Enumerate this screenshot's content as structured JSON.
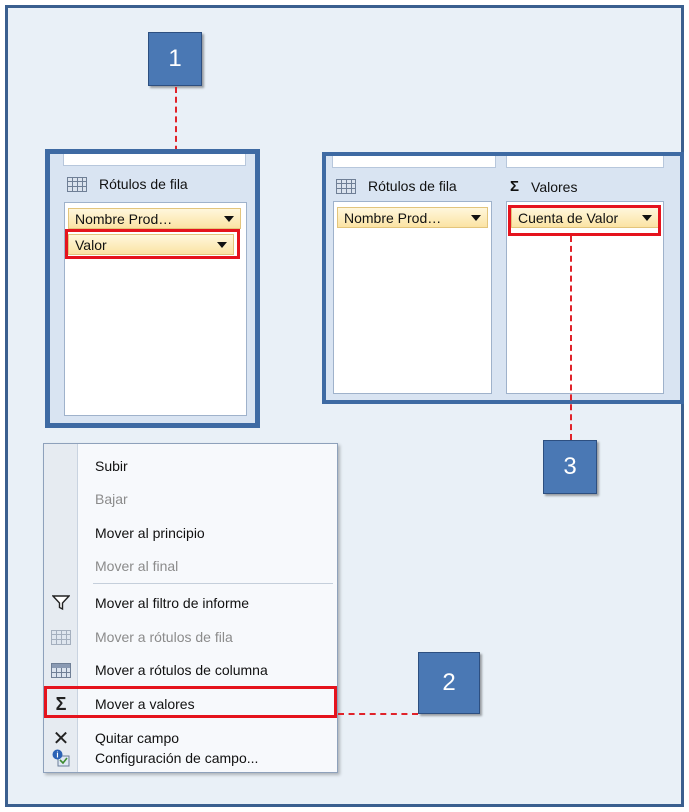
{
  "callouts": {
    "one": "1",
    "two": "2",
    "three": "3"
  },
  "panel_a": {
    "header": "Rótulos de fila",
    "fields": [
      {
        "label": "Nombre Prod…"
      },
      {
        "label": "Valor"
      }
    ]
  },
  "panel_b": {
    "rows_header": "Rótulos de fila",
    "values_symbol": "Σ",
    "values_header": "Valores",
    "rows_field": "Nombre Prod…",
    "values_field": "Cuenta de Valor"
  },
  "menu": {
    "items": [
      {
        "label": "Subir",
        "icon": "",
        "enabled": true
      },
      {
        "label": "Bajar",
        "icon": "",
        "enabled": false
      },
      {
        "label": "Mover al principio",
        "icon": "",
        "enabled": true
      },
      {
        "label": "Mover al final",
        "icon": "",
        "enabled": false
      },
      {
        "label": "Mover al filtro de informe",
        "icon": "filter-icon",
        "enabled": true
      },
      {
        "label": "Mover a rótulos de fila",
        "icon": "row-labels-icon",
        "enabled": false
      },
      {
        "label": "Mover a rótulos de columna",
        "icon": "column-labels-icon",
        "enabled": true
      },
      {
        "label": "Mover a valores",
        "icon": "sigma-icon",
        "symbol": "Σ",
        "enabled": true
      },
      {
        "label": "Quitar campo",
        "icon": "remove-icon",
        "symbol": "✕",
        "enabled": true
      },
      {
        "label": "Configuración de campo...",
        "icon": "field-settings-icon",
        "enabled": true
      }
    ]
  },
  "colors": {
    "highlight": "#e5131d",
    "callout": "#4a78b4",
    "panel_border": "#3e6aa3"
  }
}
